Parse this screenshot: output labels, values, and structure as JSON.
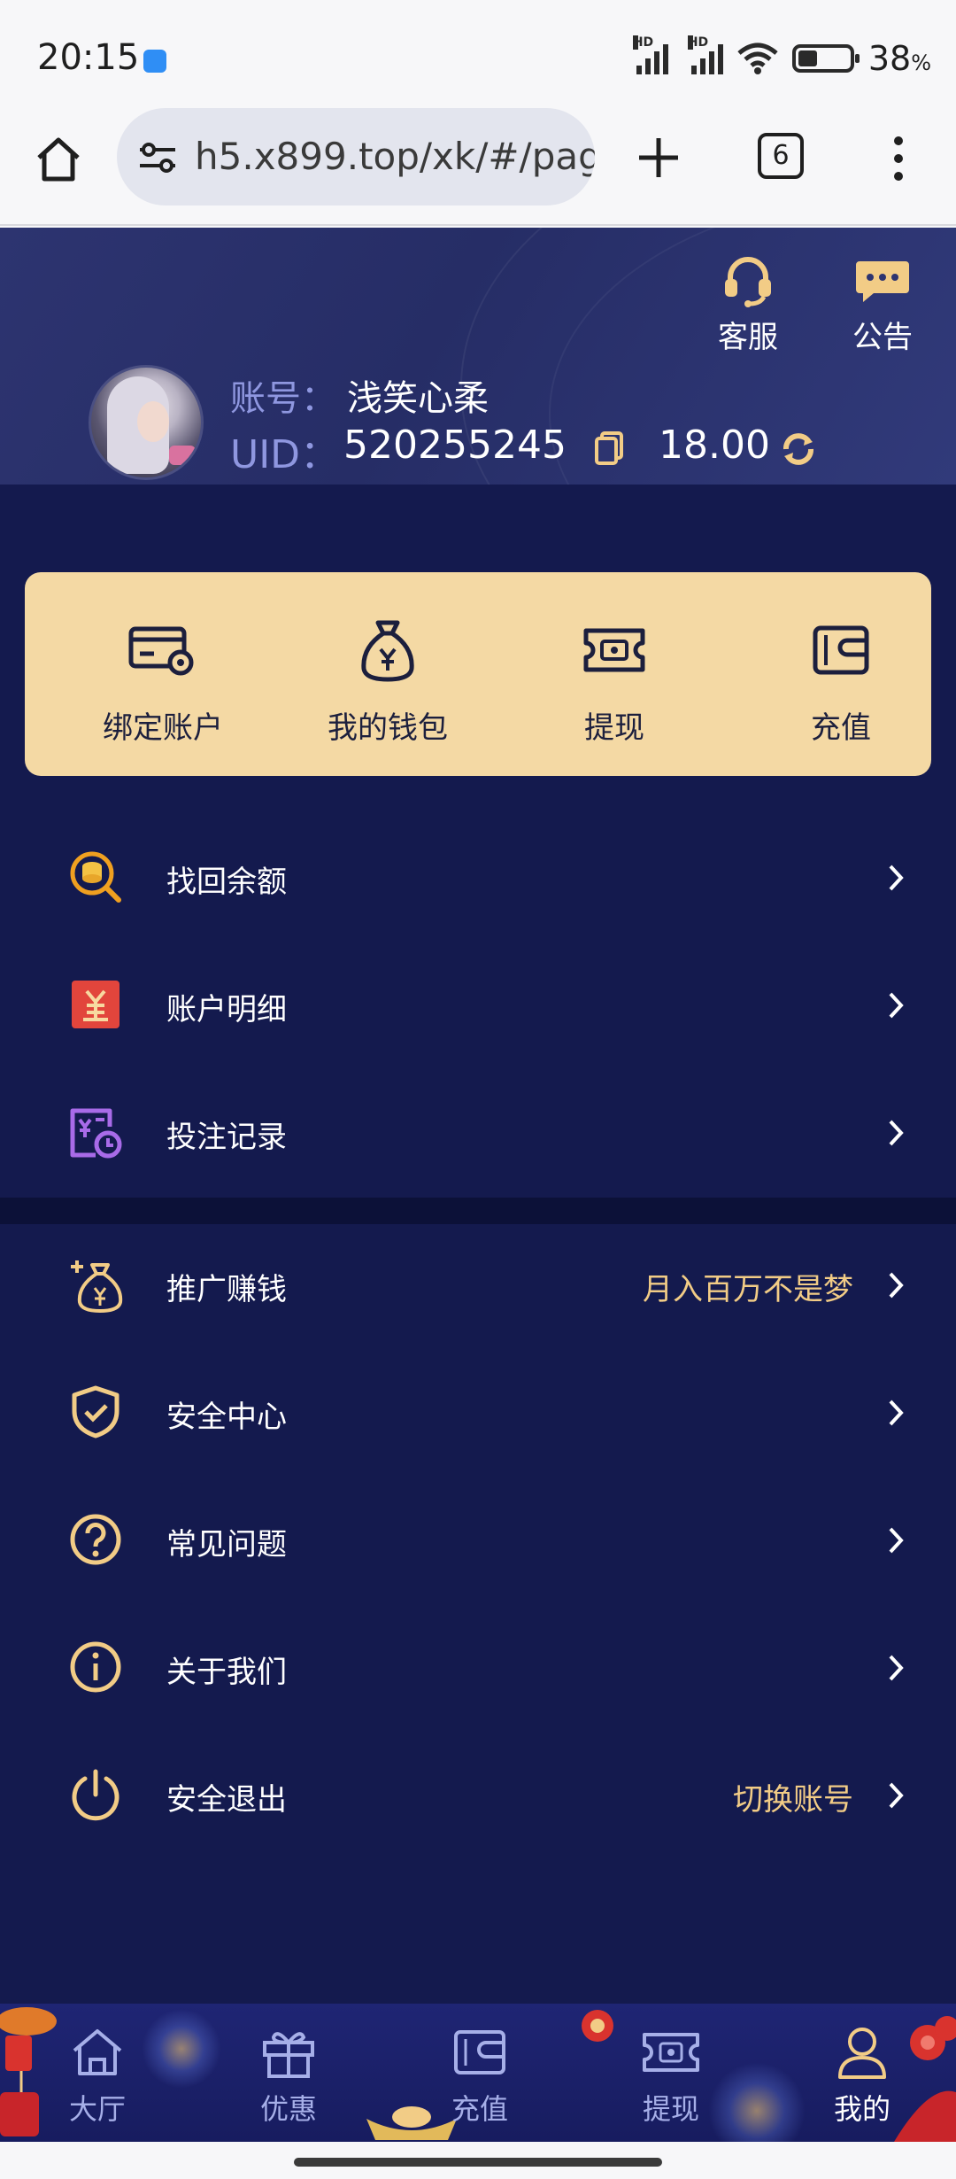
{
  "status_bar": {
    "time": "20:15",
    "hd1": "HD",
    "hd2": "HD",
    "battery_percent": "38",
    "battery_unit": "%",
    "battery_level": 0.38
  },
  "browser": {
    "url": "h5.x899.top/xk/#/page",
    "tab_count": "6"
  },
  "header": {
    "customer_service_label": "客服",
    "announcement_label": "公告",
    "account_label": "账号：",
    "account_name": "浅笑心柔",
    "uid_label": "UID：",
    "uid_value": "520255245",
    "balance": "18.00",
    "accent_color": "#f2cc86"
  },
  "quick_actions": [
    {
      "label": "绑定账户",
      "icon": "card-gear-icon"
    },
    {
      "label": "我的钱包",
      "icon": "money-bag-icon"
    },
    {
      "label": "提现",
      "icon": "ticket-cash-icon"
    },
    {
      "label": "充值",
      "icon": "wallet-icon"
    }
  ],
  "menu_group_1": [
    {
      "label": "找回余额",
      "icon": "coin-search-icon"
    },
    {
      "label": "账户明细",
      "icon": "yen-ledger-icon"
    },
    {
      "label": "投注记录",
      "icon": "bet-record-icon"
    }
  ],
  "menu_group_2": [
    {
      "label": "推广赚钱",
      "icon": "money-bag-plus-icon",
      "extra": "月入百万不是梦"
    },
    {
      "label": "安全中心",
      "icon": "shield-check-icon"
    },
    {
      "label": "常见问题",
      "icon": "question-icon"
    },
    {
      "label": "关于我们",
      "icon": "info-icon"
    },
    {
      "label": "安全退出",
      "icon": "power-icon",
      "extra": "切换账号"
    }
  ],
  "bottom_nav": [
    {
      "label": "大厅",
      "icon": "home-icon"
    },
    {
      "label": "优惠",
      "icon": "gift-icon"
    },
    {
      "label": "充值",
      "icon": "wallet-icon"
    },
    {
      "label": "提现",
      "icon": "ticket-cash-icon"
    },
    {
      "label": "我的",
      "icon": "user-icon",
      "active": true
    }
  ]
}
